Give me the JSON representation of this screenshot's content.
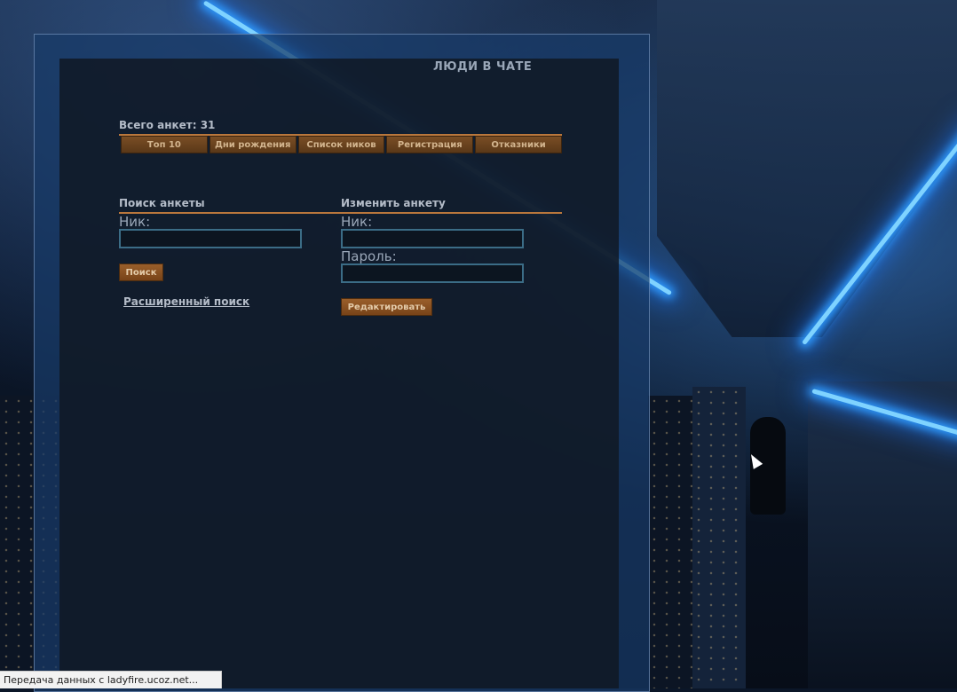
{
  "header": {
    "title": "ЛЮДИ В ЧАТЕ"
  },
  "summary": {
    "total": "Всего анкет: 31"
  },
  "tabs": [
    {
      "label": "Топ 10"
    },
    {
      "label": "Дни рождения"
    },
    {
      "label": "Список ников"
    },
    {
      "label": "Регистрация"
    },
    {
      "label": "Отказники"
    }
  ],
  "search": {
    "title": "Поиск анкеты",
    "nick_label": "Ник:",
    "nick_value": "",
    "button": "Поиск",
    "advanced_link": "Расширенный поиск"
  },
  "edit": {
    "title": "Изменить анкету",
    "nick_label": "Ник:",
    "nick_value": "",
    "password_label": "Пароль:",
    "password_value": "",
    "button": "Редактировать"
  },
  "statusbar": {
    "text": "Передача данных с ladyfire.ucoz.net..."
  },
  "colors": {
    "accent": "#b9773c",
    "button": "#8a5424",
    "field_border": "#3b6c86",
    "panel": "#183a68"
  }
}
